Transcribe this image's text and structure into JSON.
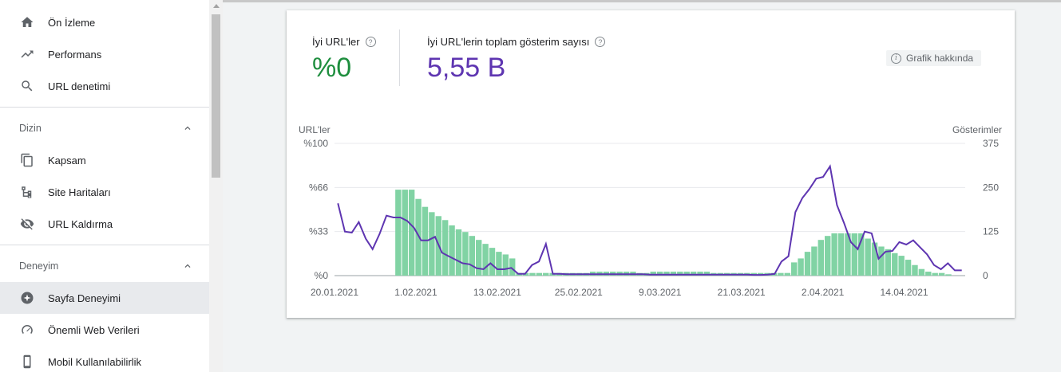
{
  "sidebar": {
    "items_top": [
      {
        "label": "Ön İzleme",
        "icon": "home-icon"
      },
      {
        "label": "Performans",
        "icon": "trending-up-icon"
      },
      {
        "label": "URL denetimi",
        "icon": "search-icon"
      }
    ],
    "sections": [
      {
        "title": "Dizin",
        "items": [
          {
            "label": "Kapsam",
            "icon": "copy-icon"
          },
          {
            "label": "Site Haritaları",
            "icon": "sitemap-icon"
          },
          {
            "label": "URL Kaldırma",
            "icon": "eye-off-icon"
          }
        ]
      },
      {
        "title": "Deneyim",
        "items": [
          {
            "label": "Sayfa Deneyimi",
            "icon": "star-badge-icon",
            "active": true
          },
          {
            "label": "Önemli Web Verileri",
            "icon": "speedometer-icon"
          },
          {
            "label": "Mobil Kullanılabilirlik",
            "icon": "phone-icon"
          }
        ]
      }
    ]
  },
  "card": {
    "metric1": {
      "label": "İyi URL'ler",
      "value": "%0",
      "color": "#1e8e3e"
    },
    "metric2": {
      "label": "İyi URL'lerin toplam gösterim sayısı",
      "value": "5,55 B",
      "color": "#5e35b1"
    },
    "about_label": "Grafik hakkında"
  },
  "chart_data": {
    "type": "bar",
    "left_axis_title": "URL'ler",
    "right_axis_title": "Gösterimler",
    "left_ticks": [
      "%0",
      "%33",
      "%66",
      "%100"
    ],
    "right_ticks": [
      "0",
      "125",
      "250",
      "375"
    ],
    "ylim_left": [
      0,
      100
    ],
    "ylim_right": [
      0,
      375
    ],
    "x_labels": [
      "20.01.2021",
      "1.02.2021",
      "13.02.2021",
      "25.02.2021",
      "9.03.2021",
      "21.03.2021",
      "2.04.2021",
      "14.04.2021"
    ],
    "x_label_index": [
      0,
      12,
      24,
      36,
      48,
      60,
      72,
      84
    ],
    "bar_color": "#81d3a4",
    "line_color": "#5e35b1",
    "series": [
      {
        "name": "İyi URL'ler",
        "kind": "bar",
        "axis": "left",
        "values": [
          0,
          0,
          0,
          0,
          0,
          0,
          0,
          0,
          0,
          65,
          65,
          65,
          58,
          52,
          48,
          45,
          42,
          38,
          35,
          33,
          30,
          27,
          24,
          21,
          18,
          16,
          13,
          2,
          2,
          2,
          2,
          2,
          2,
          2,
          2,
          2,
          2,
          2,
          3,
          3,
          3,
          3,
          3,
          3,
          3,
          2,
          2,
          3,
          3,
          3,
          3,
          3,
          3,
          3,
          3,
          3,
          2,
          2,
          2,
          2,
          2,
          2,
          2,
          2,
          2,
          2,
          2,
          2,
          10,
          13,
          18,
          22,
          27,
          30,
          32,
          32,
          32,
          32,
          32,
          28,
          25,
          22,
          20,
          17,
          15,
          12,
          8,
          5,
          3,
          2,
          2,
          1,
          0,
          0
        ]
      },
      {
        "name": "İyi URL'lerin toplam gösterim sayısı",
        "kind": "line",
        "axis": "right",
        "values": [
          205,
          125,
          122,
          152,
          105,
          75,
          118,
          170,
          165,
          165,
          155,
          135,
          100,
          100,
          110,
          65,
          55,
          45,
          35,
          32,
          21,
          18,
          35,
          18,
          18,
          22,
          5,
          5,
          30,
          40,
          90,
          5,
          5,
          4,
          4,
          4,
          4,
          4,
          4,
          4,
          4,
          4,
          4,
          4,
          4,
          3,
          3,
          3,
          3,
          3,
          3,
          3,
          3,
          3,
          3,
          3,
          3,
          3,
          3,
          3,
          2,
          2,
          3,
          5,
          40,
          55,
          180,
          220,
          245,
          275,
          280,
          310,
          200,
          150,
          95,
          75,
          125,
          120,
          48,
          68,
          70,
          95,
          88,
          100,
          80,
          60,
          30,
          18,
          35,
          15,
          15
        ]
      }
    ]
  }
}
